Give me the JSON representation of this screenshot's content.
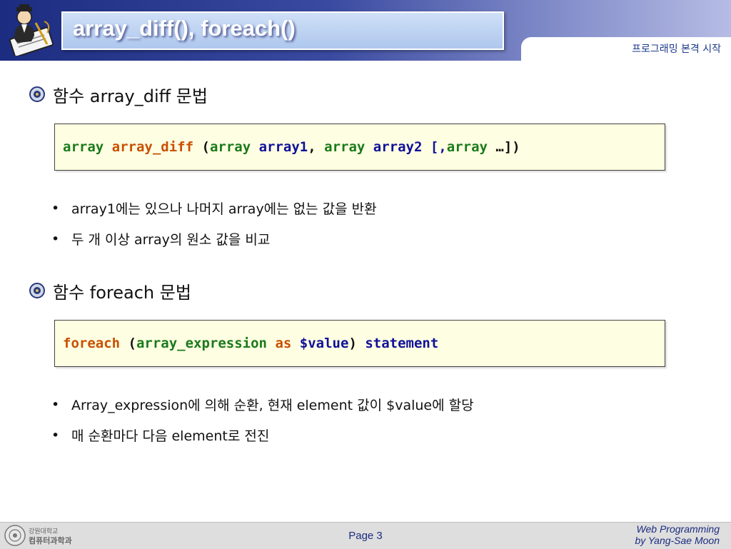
{
  "header": {
    "title": "array_diff(), foreach()",
    "subtitle": "프로그래밍 본격 시작"
  },
  "sections": [
    {
      "heading": "함수 array_diff 문법",
      "code": [
        "array",
        " ",
        "array_diff",
        " (",
        "array",
        " ",
        "array1",
        ", ",
        "array",
        " ",
        "array2",
        " [,",
        "array",
        " …])"
      ],
      "bullets": [
        "array1에는 있으나 나머지 array에는 없는 값을 반환",
        "두 개 이상 array의 원소 값을 비교"
      ]
    },
    {
      "heading": "함수 foreach 문법",
      "code": [
        "foreach",
        " (",
        "array_expression",
        " ",
        "as",
        " ",
        "$value",
        ") ",
        "statement"
      ],
      "bullets": [
        "Array_expression에 의해 순환, 현재 element 값이 $value에 할당",
        "매 순환마다 다음 element로 전진"
      ]
    }
  ],
  "footer": {
    "logo_text": [
      "강원대학교",
      "컴퓨터과학과"
    ],
    "page": "Page 3",
    "credit_line1": "Web Programming",
    "credit_line2": "by Yang-Sae Moon"
  },
  "colors": {
    "header_dark": "#1c2c80",
    "code_green": "#1a7a1a",
    "code_orange": "#c85000",
    "code_blue": "#10109a",
    "code_bg": "#fefee2"
  }
}
